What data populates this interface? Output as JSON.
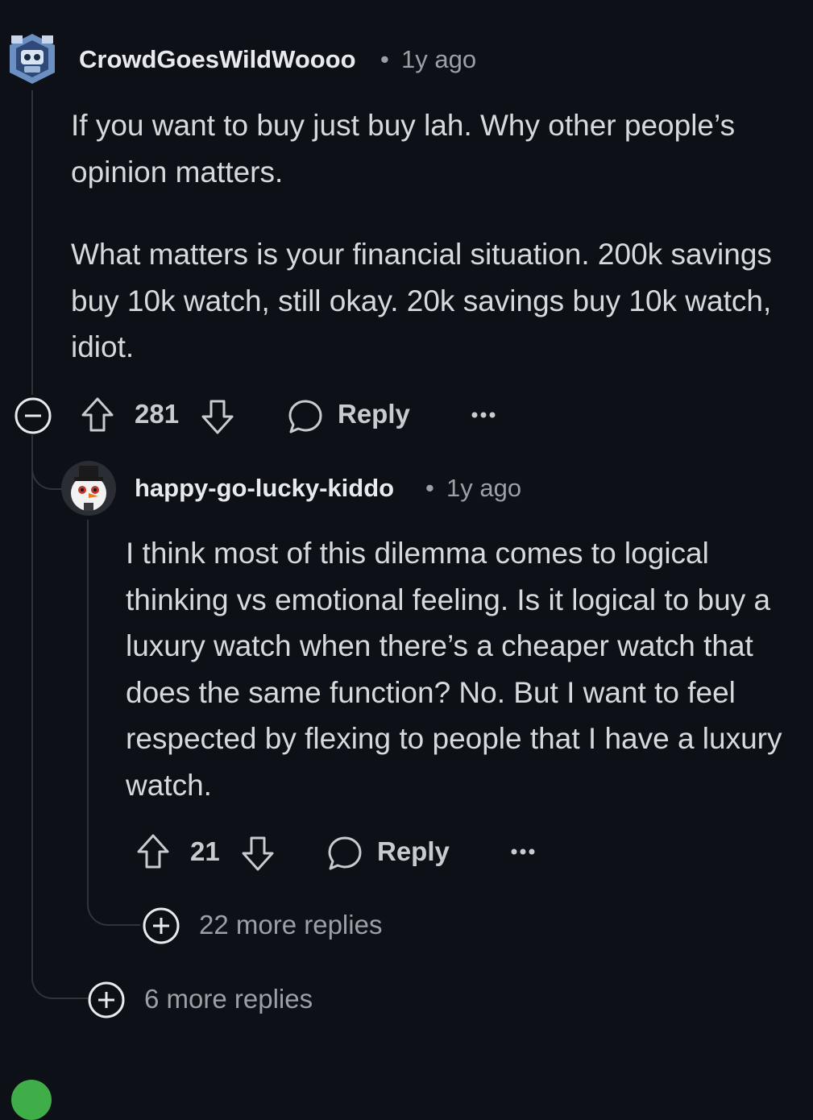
{
  "comment": {
    "avatar_icon": "robot-avatar-icon",
    "username": "CrowdGoesWildWoooo",
    "separator": "•",
    "time": "1y ago",
    "paragraphs": [
      "If you want to buy just buy lah. Why other people’s opinion matters.",
      "What matters is your financial situation. 200k savings buy 10k watch, still okay. 20k savings buy 10k watch, idiot."
    ],
    "votes": "281",
    "reply_label": "Reply"
  },
  "reply": {
    "avatar_icon": "snowman-avatar-icon",
    "username": "happy-go-lucky-kiddo",
    "separator": "•",
    "time": "1y ago",
    "paragraphs": [
      "I think most of this dilemma comes to logical thinking vs emotional feeling. Is it logical to buy a luxury watch when there’s a cheaper watch that does the same function? No. But I want to feel respected by flexing to people that I have a luxury watch."
    ],
    "votes": "21",
    "reply_label": "Reply",
    "more_replies": "22 more replies"
  },
  "thread": {
    "more_replies": "6 more replies"
  },
  "colors": {
    "background": "#0d1117",
    "text": "#d7dadc",
    "muted": "#9aa0a6",
    "thread_line": "#30343a"
  }
}
